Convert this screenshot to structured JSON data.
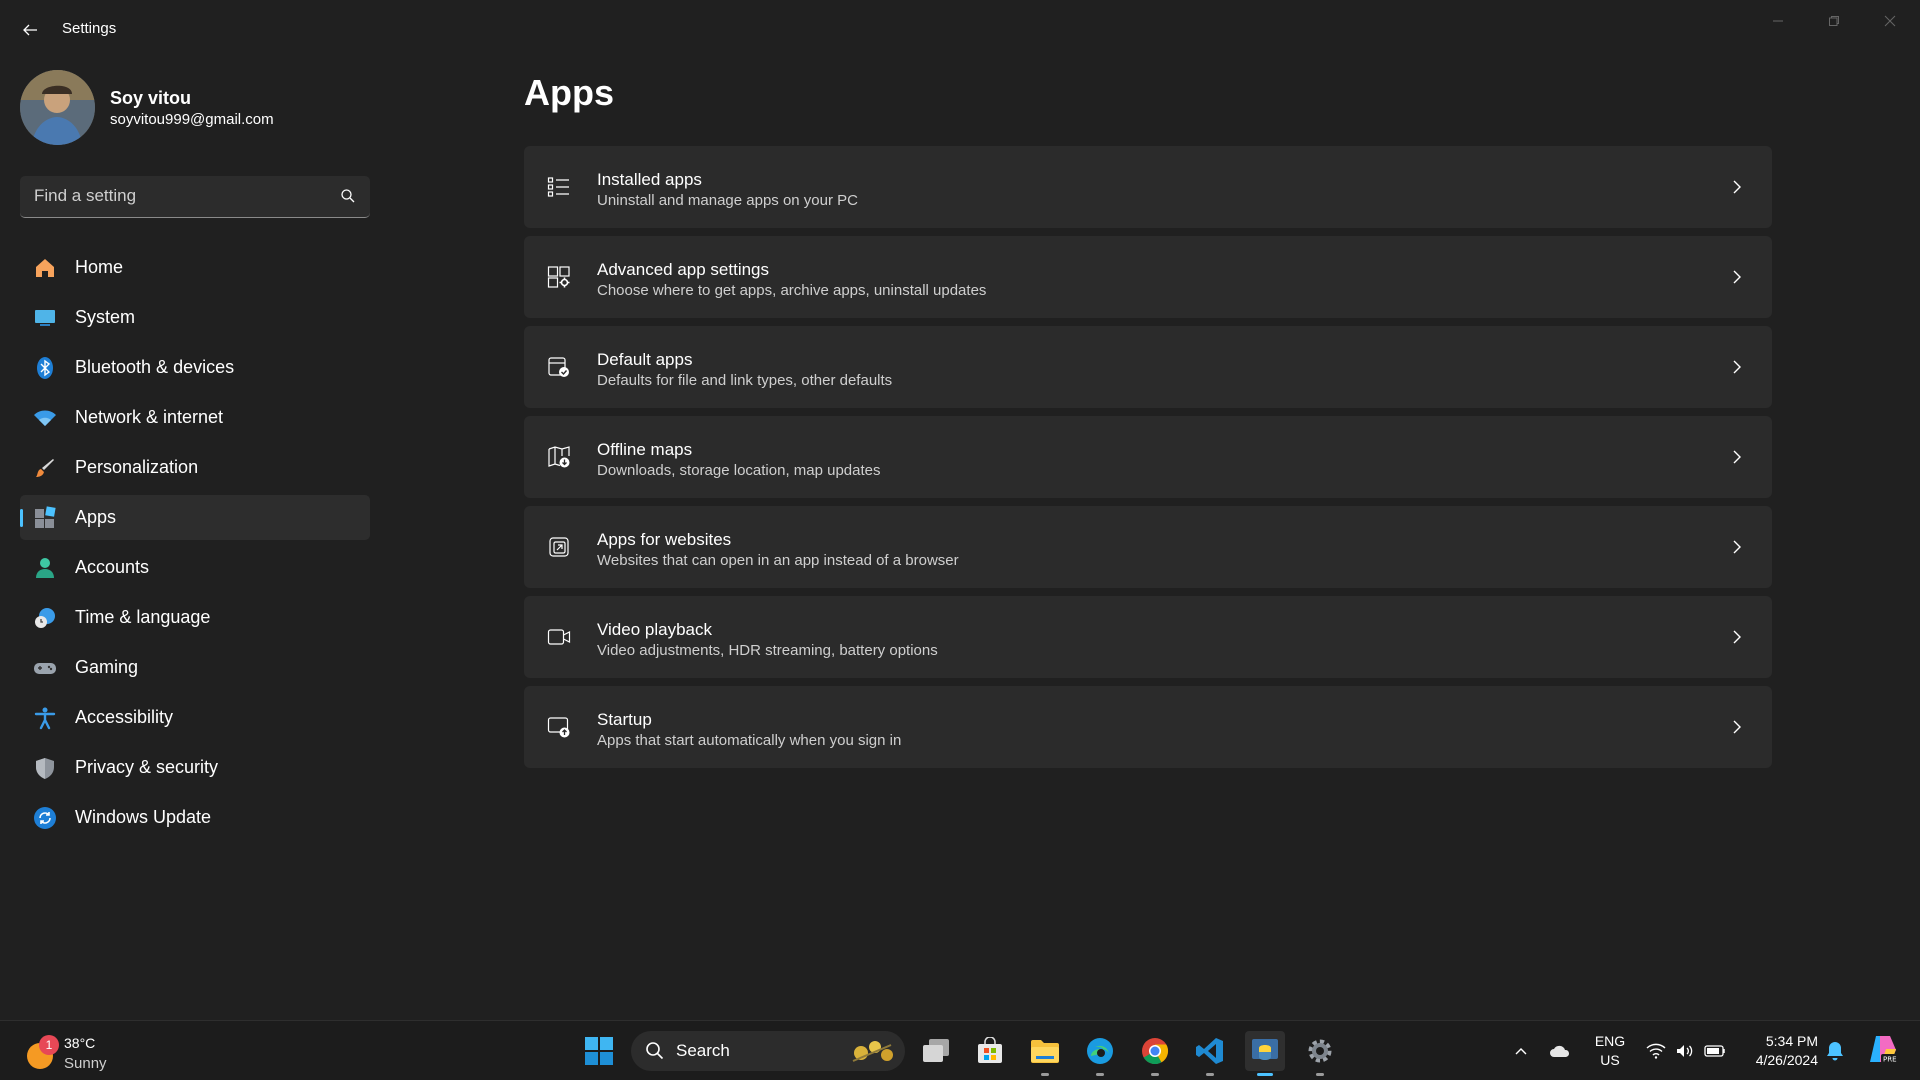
{
  "window": {
    "title": "Settings"
  },
  "profile": {
    "name": "Soy vitou",
    "email": "soyvitou999@gmail.com"
  },
  "search": {
    "placeholder": "Find a setting"
  },
  "sidebar": {
    "items": [
      {
        "label": "Home",
        "icon": "home-icon"
      },
      {
        "label": "System",
        "icon": "system-icon"
      },
      {
        "label": "Bluetooth & devices",
        "icon": "bluetooth-icon"
      },
      {
        "label": "Network & internet",
        "icon": "wifi-icon"
      },
      {
        "label": "Personalization",
        "icon": "brush-icon"
      },
      {
        "label": "Apps",
        "icon": "apps-icon",
        "selected": true
      },
      {
        "label": "Accounts",
        "icon": "account-icon"
      },
      {
        "label": "Time & language",
        "icon": "clock-globe-icon"
      },
      {
        "label": "Gaming",
        "icon": "gamepad-icon"
      },
      {
        "label": "Accessibility",
        "icon": "accessibility-icon"
      },
      {
        "label": "Privacy & security",
        "icon": "shield-icon"
      },
      {
        "label": "Windows Update",
        "icon": "update-icon"
      }
    ]
  },
  "main": {
    "title": "Apps",
    "cards": [
      {
        "title": "Installed apps",
        "subtitle": "Uninstall and manage apps on your PC",
        "icon": "list-icon"
      },
      {
        "title": "Advanced app settings",
        "subtitle": "Choose where to get apps, archive apps, uninstall updates",
        "icon": "app-gear-icon"
      },
      {
        "title": "Default apps",
        "subtitle": "Defaults for file and link types, other defaults",
        "icon": "default-apps-icon"
      },
      {
        "title": "Offline maps",
        "subtitle": "Downloads, storage location, map updates",
        "icon": "map-download-icon"
      },
      {
        "title": "Apps for websites",
        "subtitle": "Websites that can open in an app instead of a browser",
        "icon": "open-in-app-icon"
      },
      {
        "title": "Video playback",
        "subtitle": "Video adjustments, HDR streaming, battery options",
        "icon": "video-camera-icon"
      },
      {
        "title": "Startup",
        "subtitle": "Apps that start automatically when you sign in",
        "icon": "startup-icon"
      }
    ]
  },
  "taskbar": {
    "weather": {
      "temp": "38°C",
      "condition": "Sunny",
      "badge": "1"
    },
    "search_label": "Search",
    "language": {
      "lang": "ENG",
      "region": "US"
    },
    "clock": {
      "time": "5:34 PM",
      "date": "4/26/2024"
    }
  },
  "colors": {
    "background": "#202020",
    "card": "#2b2b2b",
    "accent": "#4cc2ff",
    "taskbar": "#1c1c1c"
  }
}
